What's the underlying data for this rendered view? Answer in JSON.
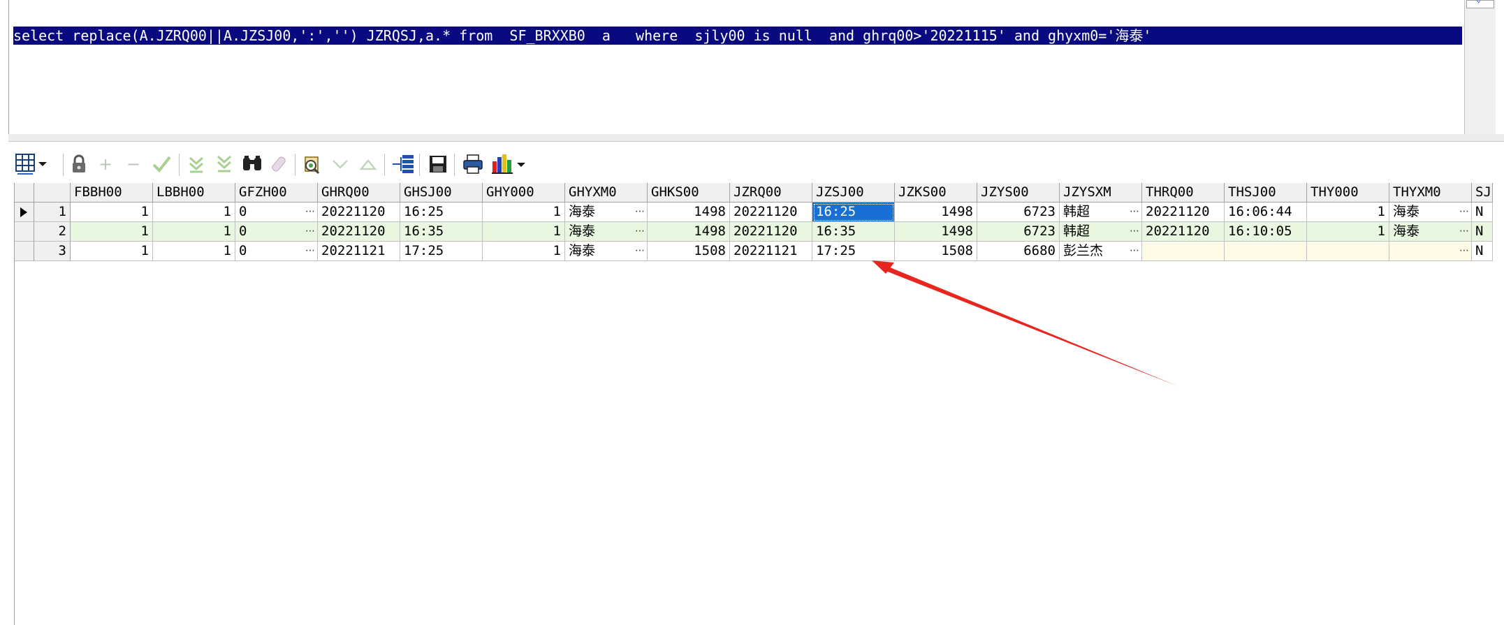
{
  "editor": {
    "sql": "select replace(A.JZRQ00||A.JZSJ00,':','') JZRQSJ,a.* from  SF_BRXXB0  a   where  sjly00 is null  and ghrq00>'20221115' and ghyxm0='海泰'"
  },
  "toolbar": {
    "icons": [
      "grid-options-icon",
      "lock-icon",
      "add-record-icon",
      "delete-record-icon",
      "post-icon",
      "fetch-next-icon",
      "fetch-all-icon",
      "find-icon",
      "clear-icon",
      "query-by-example-icon",
      "sort-down-icon",
      "sort-up-icon",
      "export-tree-icon",
      "save-icon",
      "print-icon",
      "chart-icon"
    ]
  },
  "colors": {
    "selection": "#0a0a80",
    "row_alt": "#e8f8e0",
    "selected_cell": "#1a6fd4",
    "arrow": "#e8251f"
  },
  "grid": {
    "columns": [
      "FBBH00",
      "LBBH00",
      "GFZH00",
      "GHRQ00",
      "GHSJ00",
      "GHY000",
      "GHYXM0",
      "GHKS00",
      "JZRQ00",
      "JZSJ00",
      "JZKS00",
      "JZYS00",
      "JZYSXM",
      "THRQ00",
      "THSJ00",
      "THY000",
      "THYXM0",
      "SJ"
    ],
    "rows": [
      {
        "num": "1",
        "cells": [
          "1",
          "1",
          "0",
          "20221120",
          "16:25",
          "1",
          "海泰",
          "1498",
          "20221120",
          "16:25",
          "1498",
          "6723",
          "韩超",
          "20221120",
          "16:06:44",
          "1",
          "海泰",
          "N"
        ]
      },
      {
        "num": "2",
        "cells": [
          "1",
          "1",
          "0",
          "20221120",
          "16:35",
          "1",
          "海泰",
          "1498",
          "20221120",
          "16:35",
          "1498",
          "6723",
          "韩超",
          "20221120",
          "16:10:05",
          "1",
          "海泰",
          "N"
        ]
      },
      {
        "num": "3",
        "cells": [
          "1",
          "1",
          "0",
          "20221121",
          "17:25",
          "1",
          "海泰",
          "1508",
          "20221121",
          "17:25",
          "1508",
          "6680",
          "彭兰杰",
          "",
          "",
          "",
          "",
          "N"
        ]
      }
    ]
  }
}
